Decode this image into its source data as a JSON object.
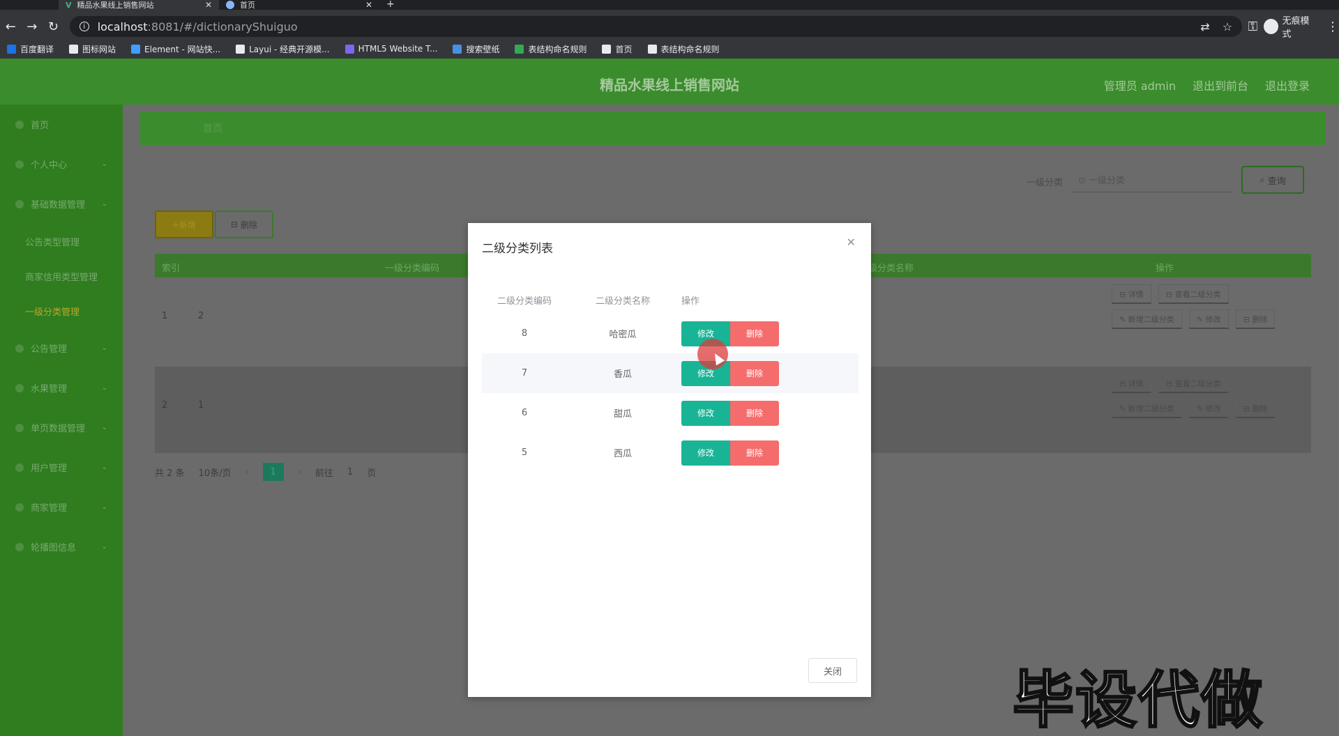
{
  "browser": {
    "tabs": [
      {
        "title": "精品水果线上销售网站",
        "active": true
      },
      {
        "title": "首页",
        "active": false
      }
    ],
    "url_host": "localhost",
    "url_rest": ":8081/#/dictionaryShuiguo",
    "incognito_label": "无痕模式",
    "bookmarks": [
      {
        "label": "百度翻译",
        "color": "#1a73e8"
      },
      {
        "label": "图标网站",
        "color": "#e8eaed"
      },
      {
        "label": "Element - 网站快...",
        "color": "#409eff"
      },
      {
        "label": "Layui - 经典开源模...",
        "color": "#e8eaed"
      },
      {
        "label": "HTML5 Website T...",
        "color": "#7b68ee"
      },
      {
        "label": "搜索壁纸",
        "color": "#4a90e2"
      },
      {
        "label": "表结构命名规则",
        "color": "#34a853"
      },
      {
        "label": "首页",
        "color": "#e8eaed"
      },
      {
        "label": "表结构命名规则",
        "color": "#e8eaed"
      }
    ]
  },
  "app": {
    "site_title": "精品水果线上销售网站",
    "top_links": [
      "管理员 admin",
      "退出到前台",
      "退出登录"
    ],
    "sidebar": {
      "items": [
        {
          "label": "首页",
          "arrow": false
        },
        {
          "label": "个人中心",
          "arrow": true
        },
        {
          "label": "基础数据管理",
          "arrow": true,
          "open": true
        }
      ],
      "subitems": [
        {
          "label": "公告类型管理",
          "active": false
        },
        {
          "label": "商家信用类型管理",
          "active": false
        },
        {
          "label": "一级分类管理",
          "active": true
        }
      ],
      "items_after": [
        {
          "label": "公告管理"
        },
        {
          "label": "水果管理"
        },
        {
          "label": "单页数据管理"
        },
        {
          "label": "用户管理"
        },
        {
          "label": "商家管理"
        },
        {
          "label": "轮播图信息"
        }
      ]
    },
    "breadcrumb": "首页",
    "filter_label": "一级分类",
    "filter_placeholder": "一级分类",
    "search_button": "查询",
    "add_button": "新增",
    "delete_button": "删除",
    "table": {
      "headers": [
        "索引",
        "一级分类编码",
        "一级分类名称",
        "操作"
      ],
      "rows": [
        {
          "index": "1",
          "code": "2"
        },
        {
          "index": "2",
          "code": "1"
        }
      ],
      "ops": [
        "详情",
        "查看二级分类",
        "新增二级分类",
        "修改",
        "删除"
      ]
    },
    "pager": {
      "total": "共 2 条",
      "per_page": "10条/页",
      "current": "1",
      "goto": "前往",
      "goto_val": "1",
      "page_word": "页"
    }
  },
  "dialog": {
    "title": "二级分类列表",
    "headers": [
      "二级分类编码",
      "二级分类名称",
      "操作"
    ],
    "rows": [
      {
        "code": "8",
        "name": "哈密瓜"
      },
      {
        "code": "7",
        "name": "香瓜"
      },
      {
        "code": "6",
        "name": "甜瓜"
      },
      {
        "code": "5",
        "name": "西瓜"
      }
    ],
    "edit_label": "修改",
    "delete_label": "删除",
    "close_label": "关闭"
  },
  "watermark": "毕设代做"
}
